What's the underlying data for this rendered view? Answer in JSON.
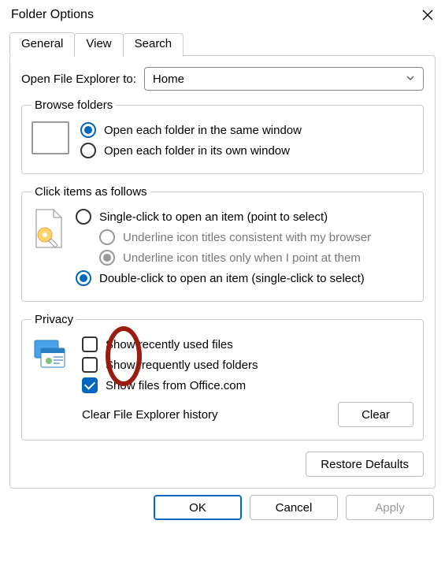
{
  "window": {
    "title": "Folder Options"
  },
  "tabs": {
    "general": "General",
    "view": "View",
    "search": "Search"
  },
  "openExplorer": {
    "label": "Open File Explorer to:",
    "value": "Home"
  },
  "browse": {
    "legend": "Browse folders",
    "sameWindow": "Open each folder in the same window",
    "ownWindow": "Open each folder in its own window"
  },
  "click": {
    "legend": "Click items as follows",
    "single": "Single-click to open an item (point to select)",
    "underlineBrowser": "Underline icon titles consistent with my browser",
    "underlinePoint": "Underline icon titles only when I point at them",
    "double": "Double-click to open an item (single-click to select)"
  },
  "privacy": {
    "legend": "Privacy",
    "recent": "Show recently used files",
    "frequent": "Show frequently used folders",
    "office": "Show files from Office.com",
    "historyLabel": "Clear File Explorer history",
    "clearBtn": "Clear"
  },
  "buttons": {
    "restore": "Restore Defaults",
    "ok": "OK",
    "cancel": "Cancel",
    "apply": "Apply"
  }
}
